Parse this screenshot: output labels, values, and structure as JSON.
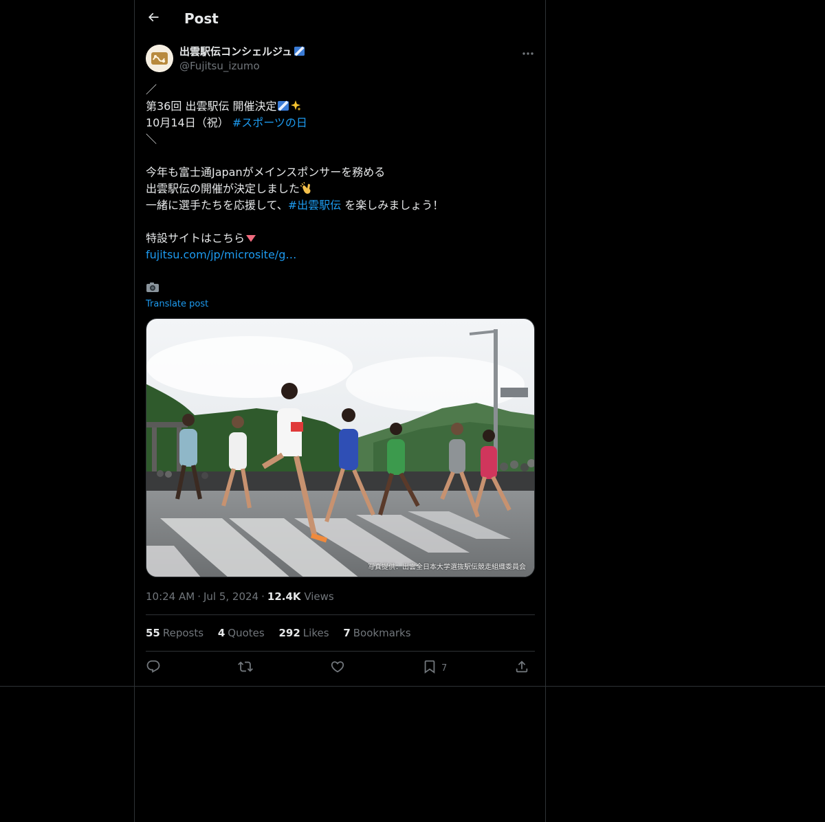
{
  "header": {
    "title": "Post"
  },
  "post": {
    "author": {
      "display_name": "出雲駅伝コンシェルジュ",
      "handle": "@Fujitsu_izumo"
    },
    "text_lines": {
      "l1": "／",
      "l2": "第36回 出雲駅伝 開催決定",
      "l3_a": "10月14日（祝）",
      "l3_hashtag": "#スポーツの日",
      "l4": "＼",
      "l6": "今年も富士通Japanがメインスポンサーを務める",
      "l7": "出雲駅伝の開催が決定しました",
      "l8_a": "一緒に選手たちを応援して、",
      "l8_hashtag": "#出雲駅伝",
      "l8_b": " を楽しみましょう！",
      "l10": "特設サイトはこちら",
      "l11_link": "fujitsu.com/jp/microsite/g…"
    },
    "translate_label": "Translate post",
    "image_credit": "写真提供：出雲全日本大学選抜駅伝競走組織委員会",
    "time": "10:24 AM",
    "date": "Jul 5, 2024",
    "views_count": "12.4K",
    "views_label": "Views",
    "stats": {
      "reposts_count": "55",
      "reposts_label": "Reposts",
      "quotes_count": "4",
      "quotes_label": "Quotes",
      "likes_count": "292",
      "likes_label": "Likes",
      "bookmarks_count": "7",
      "bookmarks_label": "Bookmarks"
    },
    "actions": {
      "bookmark_count": "7"
    }
  },
  "icons": {
    "back": "arrow-left-icon",
    "more": "more-horizontal-icon",
    "reply": "reply-icon",
    "repost": "repost-icon",
    "like": "heart-icon",
    "bookmark": "bookmark-icon",
    "share": "share-icon"
  },
  "colors": {
    "background": "#000000",
    "text": "#e7e9ea",
    "muted": "#71767b",
    "link": "#1d9bf0",
    "border": "#2f3336"
  }
}
